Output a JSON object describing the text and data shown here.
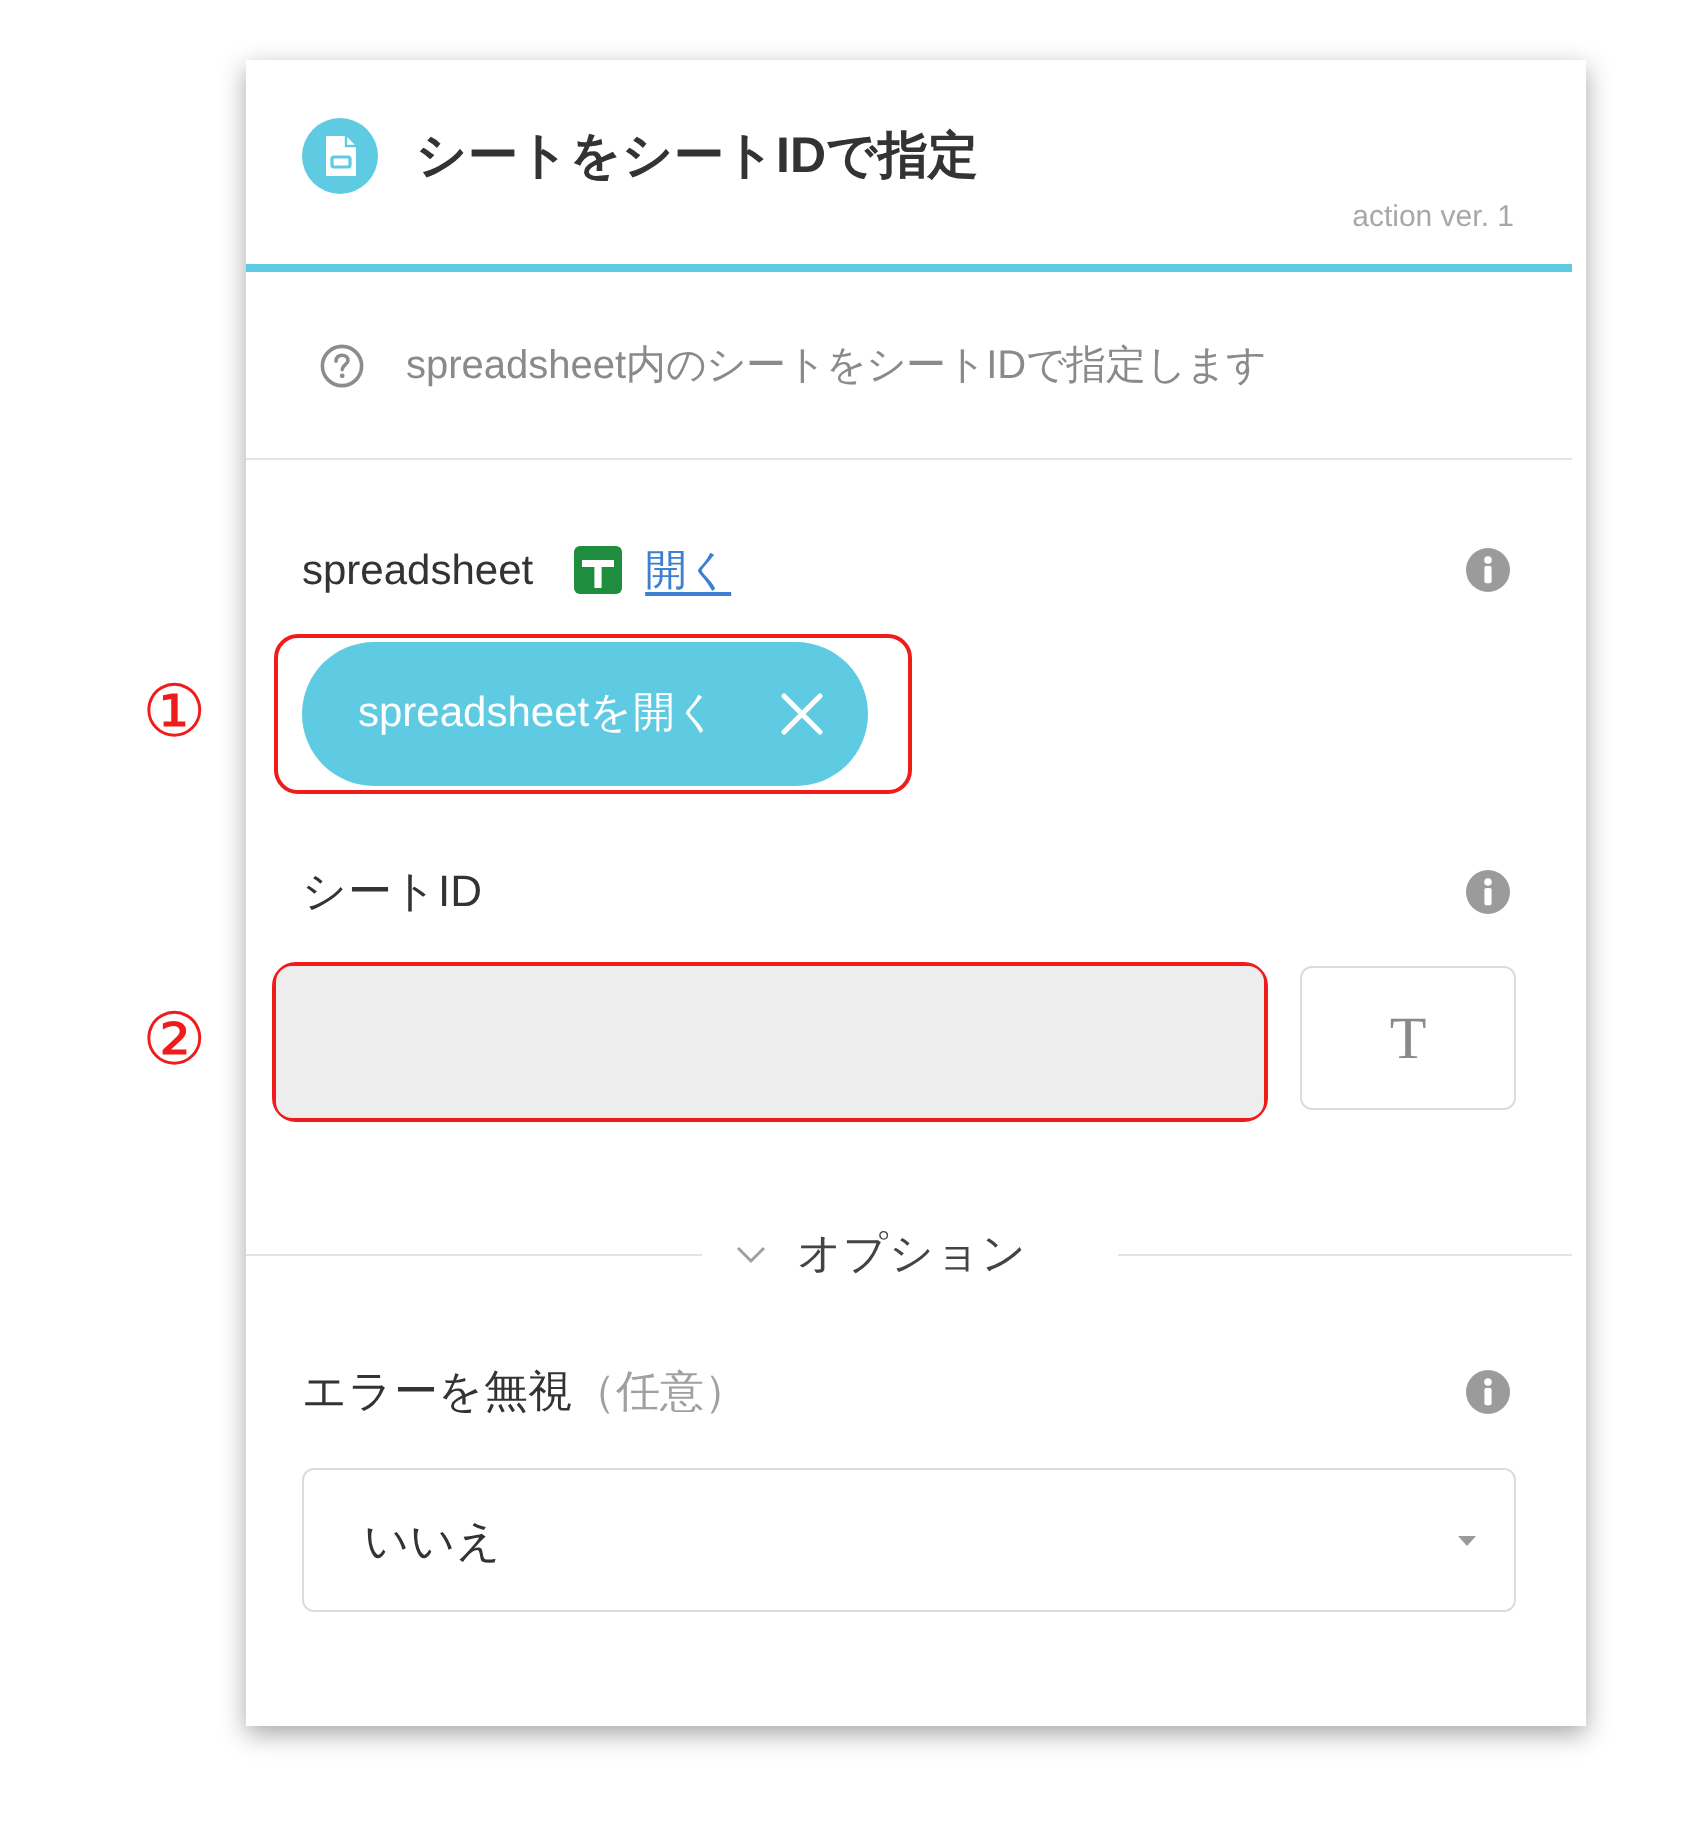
{
  "header": {
    "title": "シートをシートIDで指定",
    "version": "action ver. 1"
  },
  "description": "spreadsheet内のシートをシートIDで指定します",
  "fields": [
    {
      "kind": "file",
      "label": "spreadsheet",
      "link": "開く",
      "chip": "spreadsheetを開く",
      "annotation": "①"
    },
    {
      "kind": "text",
      "label": "シートID",
      "type_button": "T",
      "annotation": "②"
    }
  ],
  "options": {
    "title": "オプション",
    "fields": [
      {
        "kind": "select",
        "label": "エラーを無視",
        "optional": "（任意）",
        "value": "いいえ"
      }
    ]
  }
}
